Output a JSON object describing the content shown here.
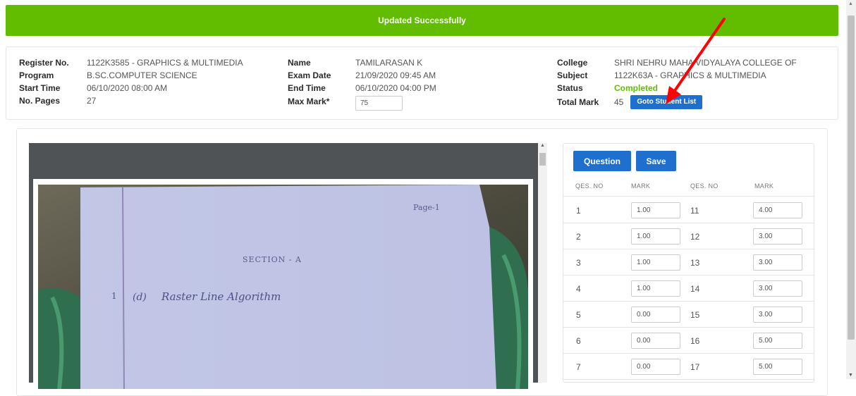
{
  "banner": {
    "message": "Updated Successfully",
    "color": "#62bd00"
  },
  "details": {
    "register_no": {
      "label": "Register No.",
      "value": "1122K3585 - GRAPHICS & MULTIMEDIA"
    },
    "program": {
      "label": "Program",
      "value": "B.SC.COMPUTER SCIENCE"
    },
    "start_time": {
      "label": "Start Time",
      "value": "06/10/2020 08:00 AM"
    },
    "no_pages": {
      "label": "No. Pages",
      "value": "27"
    },
    "name": {
      "label": "Name",
      "value": "TAMILARASAN K"
    },
    "exam_date": {
      "label": "Exam Date",
      "value": "21/09/2020 09:45 AM"
    },
    "end_time": {
      "label": "End Time",
      "value": "06/10/2020 04:00 PM"
    },
    "max_mark": {
      "label": "Max Mark*",
      "value": "75"
    },
    "college": {
      "label": "College",
      "value": "SHRI NEHRU MAHA VIDYALAYA COLLEGE OF"
    },
    "subject": {
      "label": "Subject",
      "value": "1122K63A - GRAPHICS & MULTIMEDIA"
    },
    "status": {
      "label": "Status",
      "value": "Completed"
    },
    "total_mark": {
      "label": "Total Mark",
      "value": "45"
    },
    "goto_button": "Goto Student List"
  },
  "sheet": {
    "page_label": "Page-1",
    "section_heading": "SECTION - A",
    "answer_number": "1",
    "answer_option": "(d)",
    "answer_text": "Raster Line Algorithm"
  },
  "marks_panel": {
    "question_button": "Question",
    "save_button": "Save",
    "headers": [
      "QES. NO",
      "MARK",
      "QES. NO",
      "MARK"
    ],
    "rows": [
      {
        "q1": "1",
        "m1": "1.00",
        "q2": "11",
        "m2": "4.00"
      },
      {
        "q1": "2",
        "m1": "1.00",
        "q2": "12",
        "m2": "3.00"
      },
      {
        "q1": "3",
        "m1": "1.00",
        "q2": "13",
        "m2": "3.00"
      },
      {
        "q1": "4",
        "m1": "1.00",
        "q2": "14",
        "m2": "3.00"
      },
      {
        "q1": "5",
        "m1": "0.00",
        "q2": "15",
        "m2": "3.00"
      },
      {
        "q1": "6",
        "m1": "0.00",
        "q2": "16",
        "m2": "5.00"
      },
      {
        "q1": "7",
        "m1": "0.00",
        "q2": "17",
        "m2": "5.00"
      }
    ]
  },
  "colors": {
    "primary_button": "#1f6fce",
    "status_completed": "#62bd00",
    "annotation_arrow": "#ff0000"
  }
}
